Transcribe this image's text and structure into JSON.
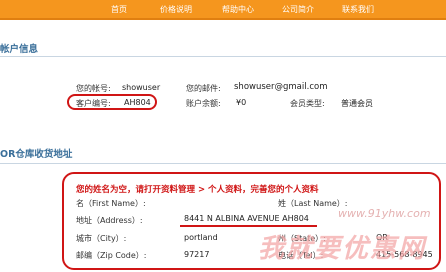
{
  "nav": {
    "items": [
      "首页",
      "价格说明",
      "帮助中心",
      "公司简介",
      "联系我们"
    ]
  },
  "account": {
    "section_title": "帐户信息",
    "username_label": "您的帐号:",
    "username_value": "showuser",
    "email_label": "您的邮件:",
    "email_value": "showuser@gmail.com",
    "customer_no_label": "客户编号:",
    "customer_no_value": "AH804",
    "balance_label": "账户余额:",
    "balance_value": "¥0",
    "member_type_label": "会员类型:",
    "member_type_value": "普通会员"
  },
  "address": {
    "section_title": "OR仓库收货地址",
    "notice": "您的姓名为空，请打开资料管理 > 个人资料，完善您的个人资料",
    "first_name_label": "名（First Name）:",
    "last_name_label": "姓（Last Name）:",
    "address_label": "地址（Address）:",
    "address_value": "8441 N ALBINA AVENUE AH804",
    "city_label": "城市（City）:",
    "city_value": "portland",
    "state_label": "州（State）:",
    "state_value": "OR",
    "zip_label": "邮编（Zip Code）:",
    "zip_value": "97217",
    "tel_label": "电话（Tel）:",
    "tel_value": "415-568-8945"
  },
  "watermark": {
    "url": "www.91yhw.com",
    "brand": "我就要优惠网"
  },
  "colors": {
    "nav": "#f5961e",
    "section_title": "#3a6f9a",
    "highlight": "#d01515"
  }
}
